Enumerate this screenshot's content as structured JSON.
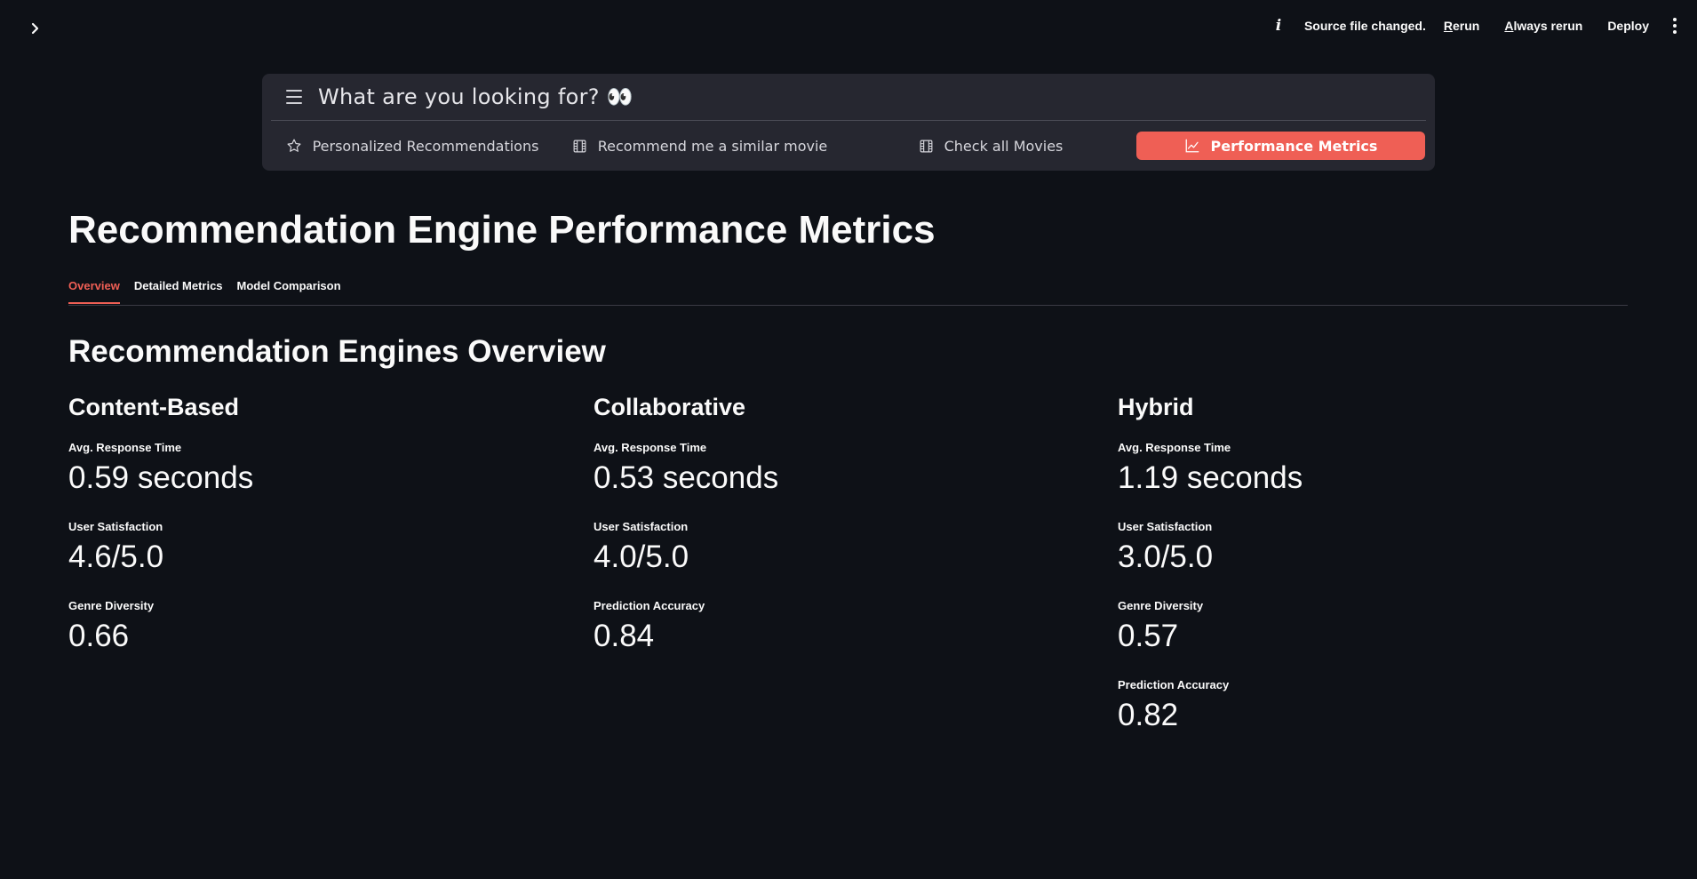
{
  "header": {
    "status_text": "Source file changed.",
    "rerun_label": "Rerun",
    "always_rerun_label": "Always rerun",
    "deploy_label": "Deploy"
  },
  "nav": {
    "search_text": "What are you looking for? 👀",
    "items": [
      {
        "label": "Personalized Recommendations",
        "icon": "star-icon"
      },
      {
        "label": "Recommend me a similar movie",
        "icon": "film-icon"
      },
      {
        "label": "Check all Movies",
        "icon": "film-icon"
      },
      {
        "label": "Performance Metrics",
        "icon": "chart-line-icon",
        "active": true
      }
    ],
    "accent_color": "#ef5f55"
  },
  "page": {
    "title": "Recommendation Engine Performance Metrics",
    "tabs": [
      "Overview",
      "Detailed Metrics",
      "Model Comparison"
    ],
    "active_tab": "Overview",
    "overview_title": "Recommendation Engines Overview"
  },
  "engines": [
    {
      "name": "Content-Based",
      "metrics": [
        {
          "label": "Avg. Response Time",
          "value": "0.59 seconds"
        },
        {
          "label": "User Satisfaction",
          "value": "4.6/5.0"
        },
        {
          "label": "Genre Diversity",
          "value": "0.66"
        }
      ]
    },
    {
      "name": "Collaborative",
      "metrics": [
        {
          "label": "Avg. Response Time",
          "value": "0.53 seconds"
        },
        {
          "label": "User Satisfaction",
          "value": "4.0/5.0"
        },
        {
          "label": "Prediction Accuracy",
          "value": "0.84"
        }
      ]
    },
    {
      "name": "Hybrid",
      "metrics": [
        {
          "label": "Avg. Response Time",
          "value": "1.19 seconds"
        },
        {
          "label": "User Satisfaction",
          "value": "3.0/5.0"
        },
        {
          "label": "Genre Diversity",
          "value": "0.57"
        },
        {
          "label": "Prediction Accuracy",
          "value": "0.82"
        }
      ]
    }
  ]
}
